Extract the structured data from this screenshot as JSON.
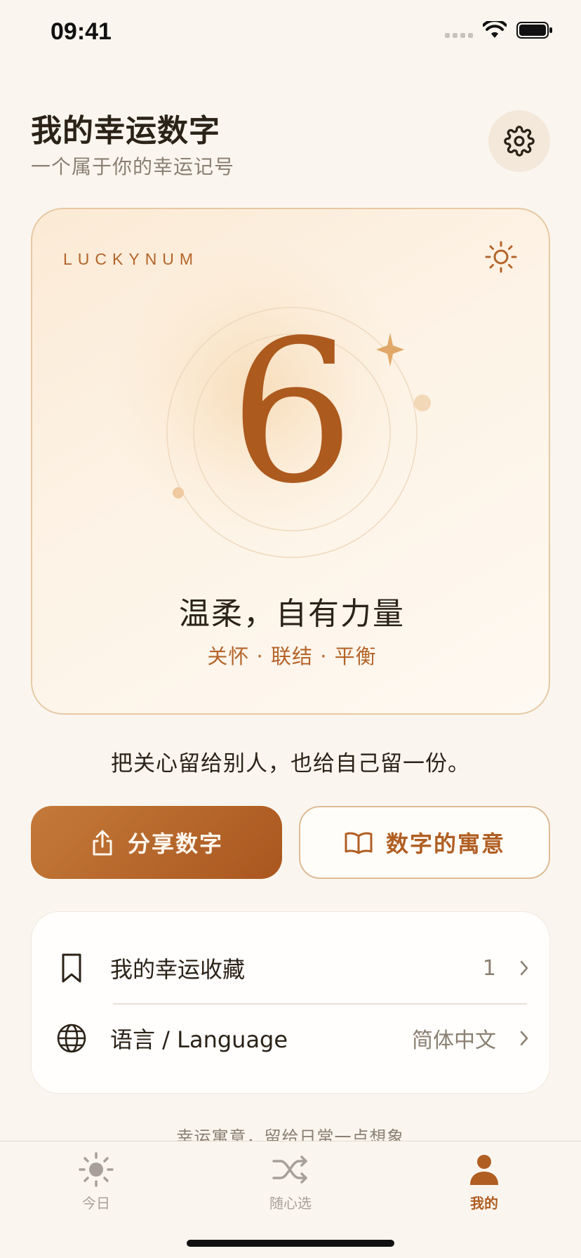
{
  "status": {
    "time": "09:41"
  },
  "header": {
    "title": "我的幸运数字",
    "subtitle": "一个属于你的幸运记号"
  },
  "card": {
    "brand": "LUCKYNUM",
    "number": "6",
    "tagline": "温柔，自有力量",
    "keywords": "关怀 · 联结 · 平衡"
  },
  "quote": "把关心留给别人，也给自己留一份。",
  "actions": {
    "share_label": "分享数字",
    "meaning_label": "数字的寓意"
  },
  "list": {
    "favorites": {
      "label": "我的幸运收藏",
      "value": "1"
    },
    "language": {
      "label": "语言 / Language",
      "value": "简体中文"
    }
  },
  "footer_note": "幸运寓意，留给日常一点想象",
  "tabs": [
    {
      "label": "今日",
      "icon": "sun-icon",
      "active": false
    },
    {
      "label": "随心选",
      "icon": "shuffle-icon",
      "active": false
    },
    {
      "label": "我的",
      "icon": "person-icon",
      "active": true
    }
  ],
  "colors": {
    "accent": "#B05E22",
    "background": "#FAF6EF",
    "number": "#AD5A1E"
  }
}
